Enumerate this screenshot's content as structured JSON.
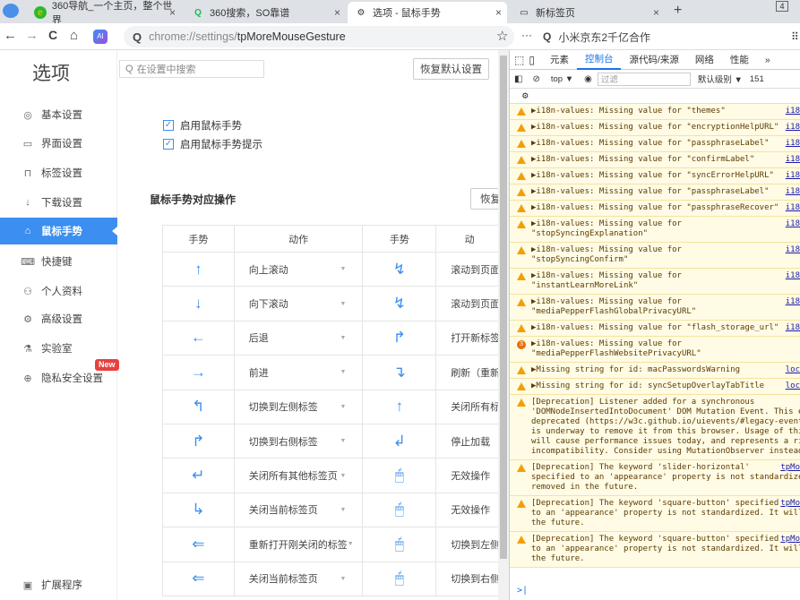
{
  "tabs": [
    {
      "title": "360导航_一个主页，整个世界",
      "close": "×"
    },
    {
      "title": "360搜索，SO靠谱",
      "close": "×"
    },
    {
      "title": "选项 - 鼠标手势",
      "close": "×"
    },
    {
      "title": "新标签页",
      "close": "×"
    }
  ],
  "tab_new": "+",
  "tab_count": "4",
  "nav": {
    "back": "←",
    "forward": "→",
    "reload": "C",
    "home": "⌂"
  },
  "omnibox": {
    "scheme": "chrome://settings/",
    "path": "tpMoreMouseGesture",
    "star": "☆",
    "more": "···"
  },
  "search_box_text": "小米京东2千亿合作",
  "settings": {
    "logo": "选项",
    "search_placeholder": "在设置中搜索",
    "restore_defaults": "恢复默认设置",
    "sidebar": [
      {
        "label": "基本设置",
        "icon": "◎"
      },
      {
        "label": "界面设置",
        "icon": "▭"
      },
      {
        "label": "标签设置",
        "icon": "⊓"
      },
      {
        "label": "下载设置",
        "icon": "↓"
      },
      {
        "label": "鼠标手势",
        "icon": "⌂"
      },
      {
        "label": "快捷键",
        "icon": "⌨"
      },
      {
        "label": "个人资料",
        "icon": "⚇"
      },
      {
        "label": "高级设置",
        "icon": "⚙"
      },
      {
        "label": "实验室",
        "icon": "⚗"
      },
      {
        "label": "隐私安全设置",
        "icon": "⊕"
      }
    ],
    "new_badge": "New",
    "extensions": {
      "label": "扩展程序",
      "icon": "▣"
    },
    "checkboxes": [
      {
        "label": "启用鼠标手势",
        "checked": true
      },
      {
        "label": "启用鼠标手势提示",
        "checked": true
      }
    ],
    "section_title": "鼠标手势对应操作",
    "restore_short": "恢复",
    "table": {
      "headers": [
        "手势",
        "动作",
        "手势",
        "动"
      ],
      "rows": [
        {
          "g1": "↑",
          "a1": "向上滚动",
          "g2": "↯",
          "a2": "滚动到页面"
        },
        {
          "g1": "↓",
          "a1": "向下滚动",
          "g2": "↯",
          "a2": "滚动到页面"
        },
        {
          "g1": "←",
          "a1": "后退",
          "g2": "↱",
          "a2": "打开新标签"
        },
        {
          "g1": "→",
          "a1": "前进",
          "g2": "↴",
          "a2": "刷新（重新"
        },
        {
          "g1": "↰",
          "a1": "切换到左侧标签",
          "g2": "↑",
          "a2": "关闭所有标"
        },
        {
          "g1": "↱",
          "a1": "切换到右侧标签",
          "g2": "↲",
          "a2": "停止加载"
        },
        {
          "g1": "↵",
          "a1": "关闭所有其他标签页",
          "g2": "🖱",
          "a2": "无效操作"
        },
        {
          "g1": "↳",
          "a1": "关闭当前标签页",
          "g2": "🖱",
          "a2": "无效操作"
        },
        {
          "g1": "⇐",
          "a1": "重新打开刚关闭的标签",
          "g2": "🖱",
          "a2": "切换到左侧"
        },
        {
          "g1": "⇐",
          "a1": "关闭当前标签页",
          "g2": "🖱",
          "a2": "切换到右侧"
        }
      ]
    }
  },
  "devtools": {
    "tabs": [
      "元素",
      "控制台",
      "源代码/来源",
      "网络",
      "性能",
      "»"
    ],
    "active_tab": "控制台",
    "context": "top ▼",
    "filter_placeholder": "过滤",
    "levels": "默认级别 ▼",
    "count": "151",
    "messages": [
      {
        "text": "▶i18n-values: Missing value for \"themes\"",
        "src": "i18"
      },
      {
        "text": "▶i18n-values: Missing value for \"encryptionHelpURL\"",
        "src": "i18"
      },
      {
        "text": "▶i18n-values: Missing value for \"passphraseLabel\"",
        "src": "i18"
      },
      {
        "text": "▶i18n-values: Missing value for \"confirmLabel\"",
        "src": "i18"
      },
      {
        "text": "▶i18n-values: Missing value for \"syncErrorHelpURL\"",
        "src": "i18"
      },
      {
        "text": "▶i18n-values: Missing value for \"passphraseLabel\"",
        "src": "i18"
      },
      {
        "text": "▶i18n-values: Missing value for \"passphraseRecover\"",
        "src": "i18"
      },
      {
        "text": "▶i18n-values: Missing value for\n\"stopSyncingExplanation\"",
        "src": "i18"
      },
      {
        "text": "▶i18n-values: Missing value for\n\"stopSyncingConfirm\"",
        "src": "i18"
      },
      {
        "text": "▶i18n-values: Missing value for\n\"instantLearnMoreLink\"",
        "src": "i18"
      },
      {
        "text": "▶i18n-values: Missing value for\n\"mediaPepperFlashGlobalPrivacyURL\"",
        "src": "i18"
      },
      {
        "text": "▶i18n-values: Missing value for \"flash_storage_url\"",
        "src": "i18"
      },
      {
        "text": "▶i18n-values: Missing value for\n\"mediaPepperFlashWebsitePrivacyURL\"",
        "src": "",
        "badge": "3"
      },
      {
        "text": "▶Missing string for id: macPasswordsWarning",
        "src": "loc"
      },
      {
        "text": "▶Missing string for id: syncSetupOverlayTabTitle",
        "src": "loc"
      },
      {
        "text": "[Deprecation] Listener added for a synchronous\n'DOMNodeInsertedIntoDocument' DOM Mutation Event. This e\ndeprecated (https://w3c.github.io/uievents/#legacy-event\nis underway to remove it from this browser. Usage of thi\nwill cause performance issues today, and represents a ri\nincompatibility. Consider using MutationObserver instead",
        "src": ""
      },
      {
        "text": "[Deprecation] The keyword 'slider-horizontal'\nspecified to an 'appearance' property is not standardize\nremoved in the future.",
        "src": "tpMo"
      },
      {
        "text": "[Deprecation] The keyword 'square-button' specified\nto an 'appearance' property is not standardized. It will\nthe future.",
        "src": "tpMo"
      },
      {
        "text": "[Deprecation] The keyword 'square-button' specified\nto an 'appearance' property is not standardized. It will\nthe future.",
        "src": "tpMo"
      }
    ],
    "prompt": ">|"
  }
}
